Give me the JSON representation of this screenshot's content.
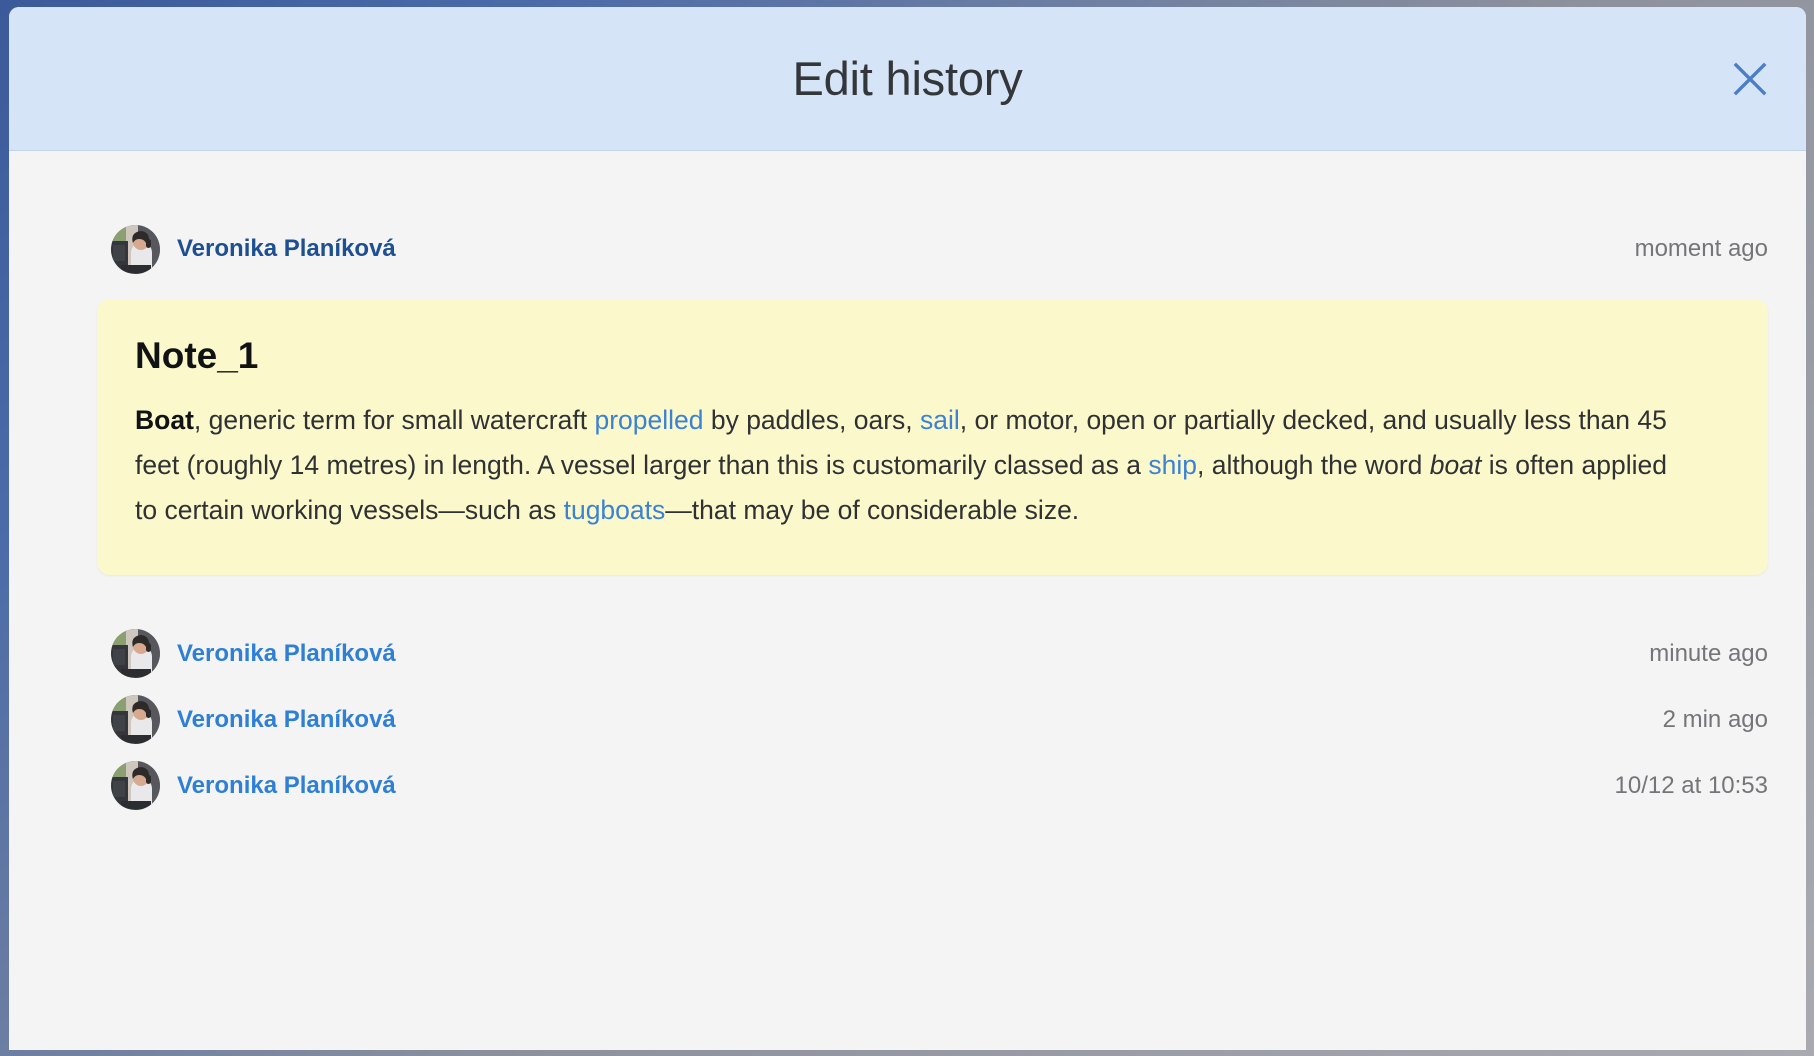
{
  "window": {
    "chrome_gradient_start": "#3c5a9a",
    "chrome_gradient_end": "#a8aab0"
  },
  "header": {
    "title": "Edit history",
    "background_color": "#d6e4f8",
    "close_label": "✕",
    "close_icon": "close-icon",
    "close_color": "#4a7fc8"
  },
  "body": {
    "background_color": "#f4f4f5"
  },
  "current_entry": {
    "author": "Veronika Planíková",
    "author_color": "#1d4f91",
    "timestamp": "moment ago",
    "avatar_icon": "user-avatar-photo"
  },
  "note": {
    "background_color": "#fbf8cb",
    "title": "Note_1",
    "text": {
      "lead_bold": "Boat",
      "seg1": ", generic term for small watercraft ",
      "link1": "propelled",
      "seg2": " by paddles, oars, ",
      "link2": "sail",
      "seg3": ", or motor, open or partially decked, and usually less than 45 feet (roughly 14 metres) in length. A vessel larger than this is customarily classed as a ",
      "link3": "ship",
      "seg4": ", although the word ",
      "italic1": "boat",
      "seg5": " is often applied to certain working vessels—such as ",
      "link4": "tugboats",
      "seg6": "—that may be of considerable size."
    },
    "link_color": "#3b82d4"
  },
  "history": {
    "entries": [
      {
        "author": "Veronika Planíková",
        "timestamp": "minute ago",
        "avatar_icon": "user-avatar-photo"
      },
      {
        "author": "Veronika Planíková",
        "timestamp": "2 min ago",
        "avatar_icon": "user-avatar-photo"
      },
      {
        "author": "Veronika Planíková",
        "timestamp": "10/12 at 10:53",
        "avatar_icon": "user-avatar-photo"
      }
    ],
    "author_color": "#2f7fd4"
  }
}
